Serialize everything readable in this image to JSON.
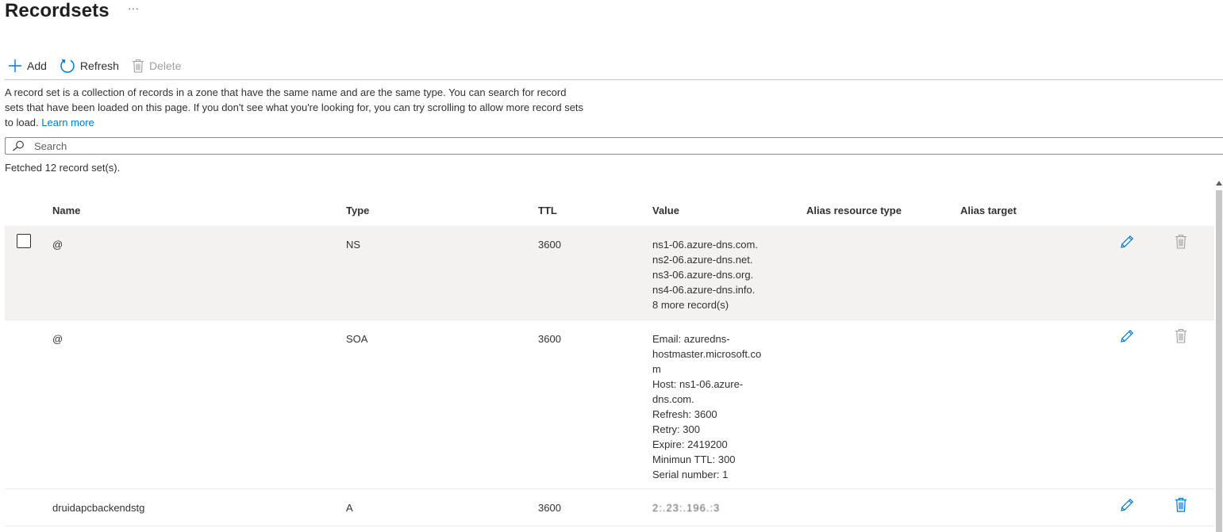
{
  "page": {
    "title": "Recordsets",
    "more_menu": "···"
  },
  "toolbar": {
    "add_label": "Add",
    "refresh_label": "Refresh",
    "delete_label": "Delete"
  },
  "description": {
    "text": "A record set is a collection of records in a zone that have the same name and are the same type. You can search for record sets that have been loaded on this page. If you don't see what you're looking for, you can try scrolling to allow more record sets to load.",
    "link": "Learn more"
  },
  "search": {
    "placeholder": "Search",
    "value": ""
  },
  "status": {
    "fetched": "Fetched 12 record set(s)."
  },
  "table": {
    "columns": {
      "name": "Name",
      "type": "Type",
      "ttl": "TTL",
      "value": "Value",
      "alias_resource_type": "Alias resource type",
      "alias_target": "Alias target"
    },
    "rows": [
      {
        "name": "@",
        "type": "NS",
        "ttl": "3600",
        "value_lines": [
          "ns1-06.azure-dns.com.",
          "ns2-06.azure-dns.net.",
          "ns3-06.azure-dns.org.",
          "ns4-06.azure-dns.info.",
          "8 more record(s)"
        ],
        "alias_resource_type": "",
        "alias_target": "",
        "hovered": true,
        "delete_enabled": false
      },
      {
        "name": "@",
        "type": "SOA",
        "ttl": "3600",
        "value_lines": [
          "Email: azuredns-",
          "hostmaster.microsoft.co",
          "m",
          "Host: ns1-06.azure-",
          "dns.com.",
          "Refresh: 3600",
          "Retry: 300",
          "Expire: 2419200",
          "Minimun TTL: 300",
          "Serial number: 1"
        ],
        "alias_resource_type": "",
        "alias_target": "",
        "hovered": false,
        "delete_enabled": false
      },
      {
        "name": "druidapcbackendstg",
        "type": "A",
        "ttl": "3600",
        "value_lines": [
          "2:.23:.196.:3"
        ],
        "alias_resource_type": "",
        "alias_target": "",
        "hovered": false,
        "delete_enabled": true
      }
    ]
  },
  "colors": {
    "accent": "#0078d4",
    "hover_row": "#f3f2f1",
    "disabled": "#a19f9d"
  },
  "icons": {
    "add": "plus-icon",
    "refresh": "refresh-icon",
    "delete": "trash-icon",
    "search": "search-icon",
    "edit": "pencil-icon"
  }
}
